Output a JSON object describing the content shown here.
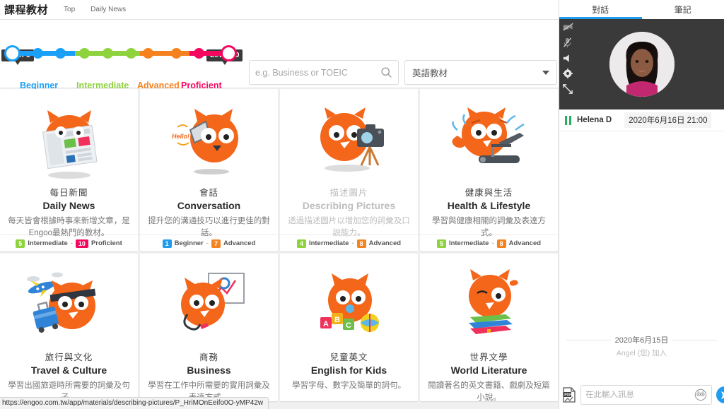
{
  "header": {
    "brand": "課程教材",
    "nav": [
      "Top",
      "Daily News"
    ]
  },
  "level_slider": {
    "start_tag": "Level 1",
    "end_tag": "Level 10",
    "labels": [
      {
        "text": "Beginner",
        "color": "#1aa0f8"
      },
      {
        "text": "Intermediate",
        "color": "#8ed23d"
      },
      {
        "text": "Advanced",
        "color": "#f5821f"
      },
      {
        "text": "Proficient",
        "color": "#f5075f"
      }
    ]
  },
  "search": {
    "placeholder": "e.g. Business or TOEIC",
    "value": "",
    "icon": "search-icon"
  },
  "material_select": {
    "value": "英語教材",
    "icon": "chevron-down-icon"
  },
  "cards": [
    {
      "title_cn": "每日新聞",
      "title_en": "Daily News",
      "desc": "每天皆會根據時事來新增文章，是Engoo最熱門的教材。",
      "min_level": "5",
      "min_label": "Intermediate",
      "min_color": "#8ed23d",
      "max_level": "10",
      "max_label": "Proficient",
      "max_color": "#f5075f",
      "illustration": "owl-reading-newspaper-icon",
      "faded": false
    },
    {
      "title_cn": "會話",
      "title_en": "Conversation",
      "desc": "提升您的溝通技巧以進行更佳的對話。",
      "min_level": "1",
      "min_label": "Beginner",
      "min_color": "#1aa0f8",
      "max_level": "7",
      "max_label": "Advanced",
      "max_color": "#f5821f",
      "illustration": "owl-with-megaphone-icon",
      "faded": false
    },
    {
      "title_cn": "描述圖片",
      "title_en": "Describing Pictures",
      "desc": "透過描述圖片以增加您的詞彙及口說能力。",
      "min_level": "4",
      "min_label": "Intermediate",
      "min_color": "#8ed23d",
      "max_level": "8",
      "max_label": "Advanced",
      "max_color": "#f5821f",
      "illustration": "owl-with-camera-icon",
      "faded": true
    },
    {
      "title_cn": "健康與生活",
      "title_en": "Health & Lifestyle",
      "desc": "學習與健康相關的詞彙及表達方式。",
      "min_level": "5",
      "min_label": "Intermediate",
      "min_color": "#8ed23d",
      "max_level": "8",
      "max_label": "Advanced",
      "max_color": "#f5821f",
      "illustration": "owl-on-treadmill-icon",
      "faded": false
    },
    {
      "title_cn": "旅行與文化",
      "title_en": "Travel & Culture",
      "desc": "學習出國旅遊時所需要的詞彙及句子。",
      "min_level": "",
      "min_label": "",
      "min_color": "",
      "max_level": "",
      "max_label": "",
      "max_color": "",
      "illustration": "owl-traveling-icon",
      "faded": false
    },
    {
      "title_cn": "商務",
      "title_en": "Business",
      "desc": "學習在工作中所需要的實用詞彙及表達方式。",
      "min_level": "",
      "min_label": "",
      "min_color": "",
      "max_level": "",
      "max_label": "",
      "max_color": "",
      "illustration": "owl-presenting-icon",
      "faded": false
    },
    {
      "title_cn": "兒童英文",
      "title_en": "English for Kids",
      "desc": "學習字母、數字及簡單的詞句。",
      "min_level": "",
      "min_label": "",
      "min_color": "",
      "max_level": "",
      "max_label": "",
      "max_color": "",
      "illustration": "owl-with-toys-icon",
      "faded": false
    },
    {
      "title_cn": "世界文學",
      "title_en": "World Literature",
      "desc": "閱讀著名的英文書籍、戲劇及短篇小說。",
      "min_level": "",
      "min_label": "",
      "min_color": "",
      "max_level": "",
      "max_label": "",
      "max_color": "",
      "illustration": "owl-on-books-icon",
      "faded": false
    }
  ],
  "status_url": "https://engoo.com.tw/app/materials/describing-pictures/P_HriMOnEeifo0O-yMP42w",
  "sidebar": {
    "tabs": [
      {
        "label": "對話",
        "active": true
      },
      {
        "label": "筆記",
        "active": false
      }
    ],
    "video_tools": [
      "camera-off-icon",
      "microphone-off-icon",
      "speaker-icon",
      "gear-icon",
      "expand-icon"
    ],
    "participant_name": "Helena D",
    "session_time": "2020年6月16日 21:00",
    "chat_date": "2020年6月15日",
    "chat_join_message": "Angel (您) 加入",
    "composer": {
      "attach_icon": "pdf-attach-icon",
      "placeholder": "在此輸入訊息",
      "value": "",
      "sticker_icon": "owl-sticker-icon",
      "send_icon": "send-icon"
    }
  },
  "colors": {
    "accent_blue": "#1f9bf0",
    "beginner": "#1aa0f8",
    "intermediate": "#8ed23d",
    "advanced": "#f5821f",
    "proficient": "#f5075f",
    "owl_orange": "#f4661a"
  }
}
